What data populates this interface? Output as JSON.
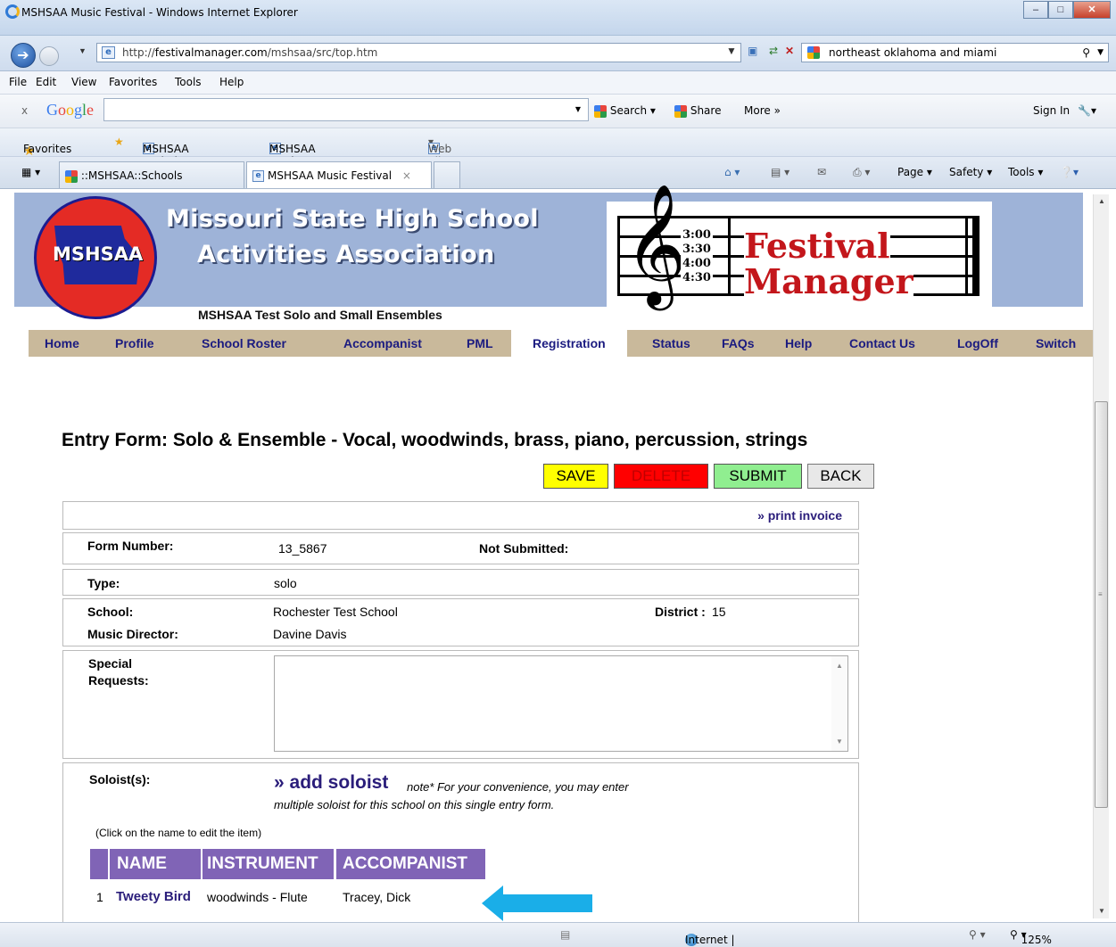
{
  "window": {
    "title": "MSHSAA Music Festival - Windows Internet Explorer"
  },
  "address": {
    "url_prefix": "http://",
    "url_host": "festivalmanager.com",
    "url_path": "/mshsaa/src/top.htm",
    "search_text": "northeast oklahoma and miami"
  },
  "menu": [
    "File",
    "Edit",
    "View",
    "Favorites",
    "Tools",
    "Help"
  ],
  "googlebar": {
    "close": "x",
    "logo": "Google",
    "search": "Search",
    "share": "Share",
    "more": "More »",
    "signin": "Sign In"
  },
  "favorites": {
    "label": "Favorites",
    "links": [
      "MSHSAA - Admin",
      "MSHSAA Music Festival",
      "Web Slice Gallery"
    ]
  },
  "tabs": {
    "tab1": "::MSHSAA::Schools",
    "tab2": "MSHSAA Music Festival",
    "close": "×"
  },
  "commandbar": {
    "page": "Page",
    "safety": "Safety",
    "tools": "Tools"
  },
  "site": {
    "logo_text": "MSHSAA",
    "org_line1": "Missouri State High School",
    "org_line2": "Activities Association",
    "subtitle": "MSHSAA Test Solo and Small Ensembles",
    "fm_word1": "Festival",
    "fm_word2": "Manager",
    "times": [
      "3:00",
      "3:30",
      "4:00",
      "4:30"
    ]
  },
  "nav": [
    "Home",
    "Profile",
    "School Roster",
    "Accompanist",
    "PML",
    "Registration",
    "Status",
    "FAQs",
    "Help",
    "Contact Us",
    "LogOff",
    "Switch"
  ],
  "nav_active": "Registration",
  "form": {
    "title": "Entry Form: Solo & Ensemble - Vocal, woodwinds, brass, piano, percussion, strings",
    "buttons": {
      "save": "SAVE",
      "delete": "DELETE",
      "submit": "SUBMIT",
      "back": "BACK"
    },
    "print_invoice": "» print invoice",
    "form_number_label": "Form Number:",
    "form_number": "13_5867",
    "not_submitted": "Not Submitted:",
    "type_label": "Type:",
    "type": "solo",
    "school_label": "School:",
    "school": "Rochester Test School",
    "district_label": "District :",
    "district": "15",
    "director_label": "Music Director:",
    "director": "Davine Davis",
    "special_label_1": "Special",
    "special_label_2": "Requests:",
    "special_value": "",
    "soloists_label": "Soloist(s):",
    "add_soloist": "» add soloist",
    "note_line1": "note* For your convenience, you may enter",
    "note_line2": "multiple soloist for this school on this single entry form.",
    "click_hint": "(Click on the name to edit the item)",
    "columns": [
      "NAME",
      "INSTRUMENT",
      "ACCOMPANIST"
    ],
    "rows": [
      {
        "num": "1",
        "name": "Tweety Bird",
        "instrument": "woodwinds - Flute",
        "accompanist": "Tracey, Dick"
      }
    ]
  },
  "status": {
    "zone": "Internet | Protected Mode: On",
    "zoom": "125%"
  },
  "colors": {
    "save": "#ffff00",
    "delete": "#ff0000",
    "submit": "#90ee90",
    "back": "#e8e8e8",
    "header": "#9eb3d8",
    "navstrip": "#c9b99b",
    "table_header": "#8064b6",
    "arrow": "#1aaee8"
  }
}
